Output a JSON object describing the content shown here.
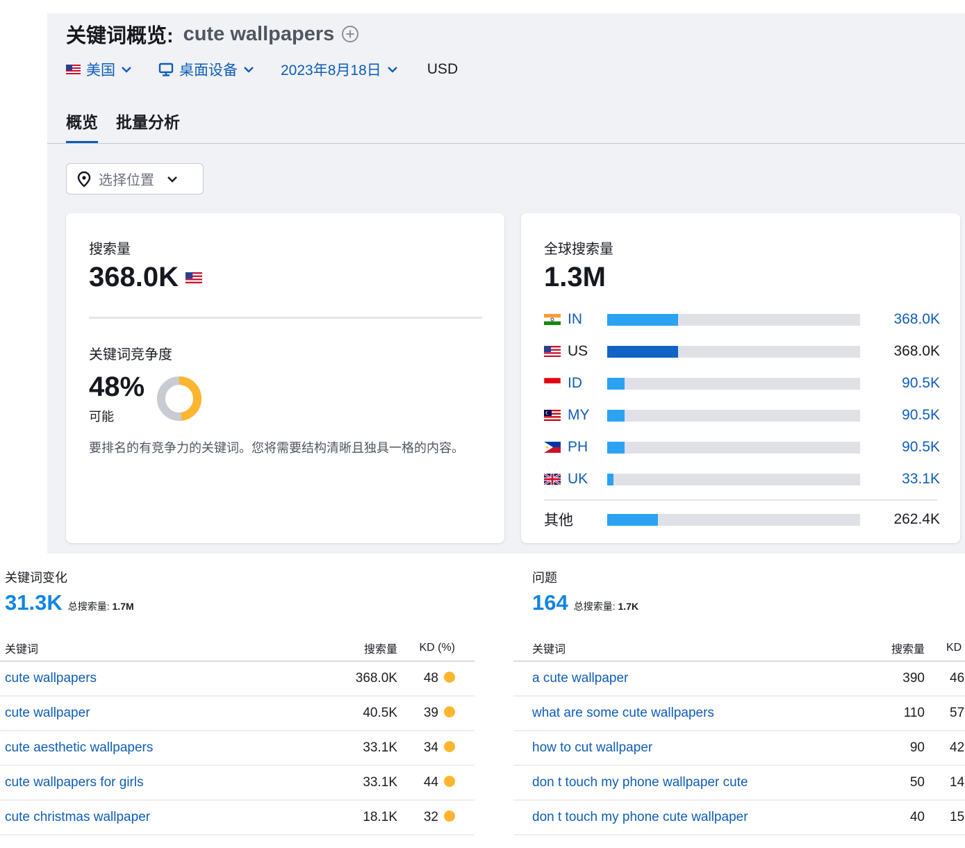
{
  "header": {
    "title_prefix": "关键词概览:",
    "keyword": "cute wallpapers"
  },
  "filters": {
    "country": "美国",
    "device": "桌面设备",
    "date": "2023年8月18日",
    "currency": "USD"
  },
  "tabs": [
    {
      "label": "概览",
      "active": true
    },
    {
      "label": "批量分析",
      "active": false
    }
  ],
  "location_select": {
    "label": "选择位置"
  },
  "volume_card": {
    "label": "搜索量",
    "value": "368.0K",
    "kd_label": "关键词竞争度",
    "kd_value": "48%",
    "kd_percent": 48,
    "kd_status": "可能",
    "kd_description": "要排名的有竞争力的关键词。您将需要结构清晰且独具一格的内容。"
  },
  "global_card": {
    "label": "全球搜索量",
    "value": "1.3M",
    "rows": [
      {
        "code": "IN",
        "value": "368.0K",
        "share": 0.28,
        "highlight": false
      },
      {
        "code": "US",
        "value": "368.0K",
        "share": 0.28,
        "highlight": true
      },
      {
        "code": "ID",
        "value": "90.5K",
        "share": 0.07,
        "highlight": false
      },
      {
        "code": "MY",
        "value": "90.5K",
        "share": 0.07,
        "highlight": false
      },
      {
        "code": "PH",
        "value": "90.5K",
        "share": 0.07,
        "highlight": false
      },
      {
        "code": "UK",
        "value": "33.1K",
        "share": 0.025,
        "highlight": false
      }
    ],
    "other": {
      "label": "其他",
      "value": "262.4K",
      "share": 0.2
    }
  },
  "variations": {
    "title": "关键词变化",
    "count": "31.3K",
    "total_label": "总搜索量:",
    "total_value": "1.7M",
    "columns": {
      "keyword": "关键词",
      "volume": "搜索量",
      "kd": "KD (%)"
    },
    "rows": [
      {
        "keyword": "cute wallpapers",
        "volume": "368.0K",
        "kd": "48"
      },
      {
        "keyword": "cute wallpaper",
        "volume": "40.5K",
        "kd": "39"
      },
      {
        "keyword": "cute aesthetic wallpapers",
        "volume": "33.1K",
        "kd": "34"
      },
      {
        "keyword": "cute wallpapers for girls",
        "volume": "33.1K",
        "kd": "44"
      },
      {
        "keyword": "cute christmas wallpaper",
        "volume": "18.1K",
        "kd": "32"
      }
    ]
  },
  "questions": {
    "title": "问题",
    "count": "164",
    "total_label": "总搜索量:",
    "total_value": "1.7K",
    "columns": {
      "keyword": "关键词",
      "volume": "搜索量",
      "kd": "KD"
    },
    "rows": [
      {
        "keyword": "a cute wallpaper",
        "volume": "390",
        "kd": "46"
      },
      {
        "keyword": "what are some cute wallpapers",
        "volume": "110",
        "kd": "57"
      },
      {
        "keyword": "how to cut wallpaper",
        "volume": "90",
        "kd": "42"
      },
      {
        "keyword": "don t touch my phone wallpaper cute",
        "volume": "50",
        "kd": "14"
      },
      {
        "keyword": "don t touch my phone cute wallpaper",
        "volume": "40",
        "kd": "15"
      }
    ]
  },
  "colors": {
    "accent": "#0f5db8",
    "bar_light": "#2ba3f2",
    "bar_dark": "#0f64c6",
    "kd_dot": "#ffb52e",
    "panel_bg": "#f1f2f6"
  }
}
